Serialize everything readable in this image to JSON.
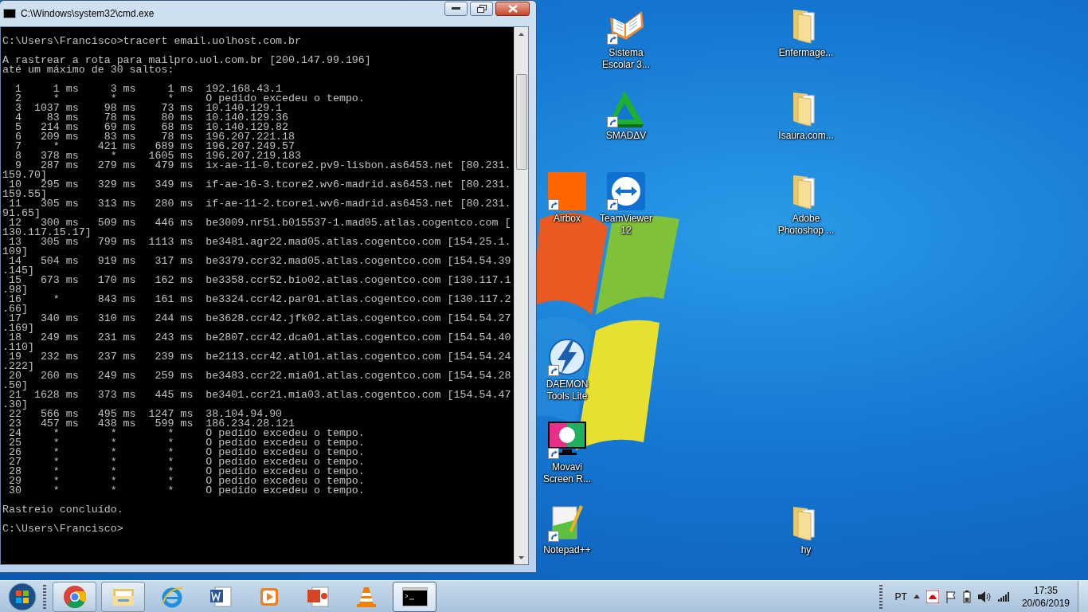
{
  "console_window": {
    "title": "C:\\Windows\\system32\\cmd.exe",
    "blocks": [
      [
        "C:\\Users\\Francisco>tracert email.uolhost.com.br"
      ],
      [
        "A rastrear a rota para mailpro.uol.com.br [200.147.99.196]",
        "até um máximo de 30 saltos:"
      ],
      [
        "  1     1 ms     3 ms     1 ms  192.168.43.1",
        "  2     *        *        *     O pedido excedeu o tempo.",
        "  3  1037 ms    98 ms    73 ms  10.140.129.1",
        "  4    83 ms    78 ms    80 ms  10.140.129.36",
        "  5   214 ms    69 ms    68 ms  10.140.129.82",
        "  6   209 ms    83 ms    78 ms  196.207.221.18",
        "  7     *      421 ms   689 ms  196.207.249.57",
        "  8   378 ms     *     1605 ms  196.207.219.183",
        "  9   287 ms   279 ms   479 ms  ix-ae-11-0.tcore2.pv9-lisbon.as6453.net [80.231.",
        "159.70]",
        " 10   295 ms   329 ms   349 ms  if-ae-16-3.tcore2.wv6-madrid.as6453.net [80.231.",
        "159.55]",
        " 11   305 ms   313 ms   280 ms  if-ae-11-2.tcore1.wv6-madrid.as6453.net [80.231.",
        "91.65]",
        " 12   300 ms   509 ms   446 ms  be3009.nr51.b015537-1.mad05.atlas.cogentco.com [",
        "130.117.15.17]",
        " 13   305 ms   799 ms  1113 ms  be3481.agr22.mad05.atlas.cogentco.com [154.25.1.",
        "109]",
        " 14   504 ms   919 ms   317 ms  be3379.ccr32.mad05.atlas.cogentco.com [154.54.39",
        ".145]",
        " 15   673 ms   170 ms   162 ms  be3358.ccr52.bio02.atlas.cogentco.com [130.117.1",
        ".98]",
        " 16     *      843 ms   161 ms  be3324.ccr42.par01.atlas.cogentco.com [130.117.2",
        ".66]",
        " 17   340 ms   310 ms   244 ms  be3628.ccr42.jfk02.atlas.cogentco.com [154.54.27",
        ".169]",
        " 18   249 ms   231 ms   243 ms  be2807.ccr42.dca01.atlas.cogentco.com [154.54.40",
        ".110]",
        " 19   232 ms   237 ms   239 ms  be2113.ccr42.atl01.atlas.cogentco.com [154.54.24",
        ".222]",
        " 20   260 ms   249 ms   259 ms  be3483.ccr22.mia01.atlas.cogentco.com [154.54.28",
        ".50]",
        " 21  1628 ms   373 ms   445 ms  be3401.ccr21.mia03.atlas.cogentco.com [154.54.47",
        ".30]",
        " 22   566 ms   495 ms  1247 ms  38.104.94.90",
        " 23   457 ms   438 ms   599 ms  186.234.28.121",
        " 24     *        *        *     O pedido excedeu o tempo.",
        " 25     *        *        *     O pedido excedeu o tempo.",
        " 26     *        *        *     O pedido excedeu o tempo.",
        " 27     *        *        *     O pedido excedeu o tempo.",
        " 28     *        *        *     O pedido excedeu o tempo.",
        " 29     *        *        *     O pedido excedeu o tempo.",
        " 30     *        *        *     O pedido excedeu o tempo."
      ],
      [
        "Rastreio concluído."
      ],
      [
        "C:\\Users\\Francisco>"
      ]
    ]
  },
  "desktop_icons": [
    {
      "kind": "book",
      "label": [
        "Sistema",
        "Escolar 3..."
      ],
      "shortcut": true
    },
    {
      "kind": "folder",
      "label": [
        "Enfermage..."
      ],
      "shortcut": false
    },
    {
      "kind": "smadav",
      "label": [
        "SMADΔV"
      ],
      "shortcut": true
    },
    {
      "kind": "folder",
      "label": [
        "Isaura.com..."
      ],
      "shortcut": false
    },
    {
      "kind": "orange",
      "label": [
        "Airbox"
      ],
      "shortcut": true
    },
    {
      "kind": "teamviewer",
      "label": [
        "TeamViewer",
        "12"
      ],
      "shortcut": true
    },
    {
      "kind": "folder",
      "label": [
        "Adobe",
        "Photoshop ..."
      ],
      "shortcut": false
    },
    {
      "kind": "daemon",
      "label": [
        "DAEMON",
        "Tools Lite"
      ],
      "shortcut": true
    },
    {
      "kind": "movavi",
      "label": [
        "Movavi",
        "Screen R..."
      ],
      "shortcut": true
    },
    {
      "kind": "notepad",
      "label": [
        "Notepad++"
      ],
      "shortcut": true
    },
    {
      "kind": "folder",
      "label": [
        "hy"
      ],
      "shortcut": false
    }
  ],
  "taskbar": {
    "items": [
      {
        "kind": "chrome",
        "running": true,
        "selected": false
      },
      {
        "kind": "explorer",
        "running": true,
        "selected": false
      },
      {
        "kind": "ie",
        "running": false,
        "selected": false
      },
      {
        "kind": "word",
        "running": false,
        "selected": false
      },
      {
        "kind": "player",
        "running": false,
        "selected": false
      },
      {
        "kind": "powerpoint",
        "running": false,
        "selected": false
      },
      {
        "kind": "vlc",
        "running": false,
        "selected": false
      },
      {
        "kind": "cmd",
        "running": true,
        "selected": true
      }
    ],
    "language": "PT",
    "time": "17:35",
    "date": "20/06/2019"
  }
}
